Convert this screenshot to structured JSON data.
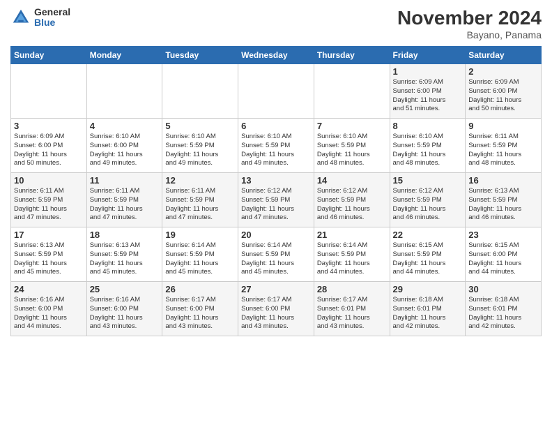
{
  "logo": {
    "general": "General",
    "blue": "Blue"
  },
  "title": "November 2024",
  "subtitle": "Bayano, Panama",
  "headers": [
    "Sunday",
    "Monday",
    "Tuesday",
    "Wednesday",
    "Thursday",
    "Friday",
    "Saturday"
  ],
  "weeks": [
    [
      {
        "day": "",
        "info": ""
      },
      {
        "day": "",
        "info": ""
      },
      {
        "day": "",
        "info": ""
      },
      {
        "day": "",
        "info": ""
      },
      {
        "day": "",
        "info": ""
      },
      {
        "day": "1",
        "info": "Sunrise: 6:09 AM\nSunset: 6:00 PM\nDaylight: 11 hours\nand 51 minutes."
      },
      {
        "day": "2",
        "info": "Sunrise: 6:09 AM\nSunset: 6:00 PM\nDaylight: 11 hours\nand 50 minutes."
      }
    ],
    [
      {
        "day": "3",
        "info": "Sunrise: 6:09 AM\nSunset: 6:00 PM\nDaylight: 11 hours\nand 50 minutes."
      },
      {
        "day": "4",
        "info": "Sunrise: 6:10 AM\nSunset: 6:00 PM\nDaylight: 11 hours\nand 49 minutes."
      },
      {
        "day": "5",
        "info": "Sunrise: 6:10 AM\nSunset: 5:59 PM\nDaylight: 11 hours\nand 49 minutes."
      },
      {
        "day": "6",
        "info": "Sunrise: 6:10 AM\nSunset: 5:59 PM\nDaylight: 11 hours\nand 49 minutes."
      },
      {
        "day": "7",
        "info": "Sunrise: 6:10 AM\nSunset: 5:59 PM\nDaylight: 11 hours\nand 48 minutes."
      },
      {
        "day": "8",
        "info": "Sunrise: 6:10 AM\nSunset: 5:59 PM\nDaylight: 11 hours\nand 48 minutes."
      },
      {
        "day": "9",
        "info": "Sunrise: 6:11 AM\nSunset: 5:59 PM\nDaylight: 11 hours\nand 48 minutes."
      }
    ],
    [
      {
        "day": "10",
        "info": "Sunrise: 6:11 AM\nSunset: 5:59 PM\nDaylight: 11 hours\nand 47 minutes."
      },
      {
        "day": "11",
        "info": "Sunrise: 6:11 AM\nSunset: 5:59 PM\nDaylight: 11 hours\nand 47 minutes."
      },
      {
        "day": "12",
        "info": "Sunrise: 6:11 AM\nSunset: 5:59 PM\nDaylight: 11 hours\nand 47 minutes."
      },
      {
        "day": "13",
        "info": "Sunrise: 6:12 AM\nSunset: 5:59 PM\nDaylight: 11 hours\nand 47 minutes."
      },
      {
        "day": "14",
        "info": "Sunrise: 6:12 AM\nSunset: 5:59 PM\nDaylight: 11 hours\nand 46 minutes."
      },
      {
        "day": "15",
        "info": "Sunrise: 6:12 AM\nSunset: 5:59 PM\nDaylight: 11 hours\nand 46 minutes."
      },
      {
        "day": "16",
        "info": "Sunrise: 6:13 AM\nSunset: 5:59 PM\nDaylight: 11 hours\nand 46 minutes."
      }
    ],
    [
      {
        "day": "17",
        "info": "Sunrise: 6:13 AM\nSunset: 5:59 PM\nDaylight: 11 hours\nand 45 minutes."
      },
      {
        "day": "18",
        "info": "Sunrise: 6:13 AM\nSunset: 5:59 PM\nDaylight: 11 hours\nand 45 minutes."
      },
      {
        "day": "19",
        "info": "Sunrise: 6:14 AM\nSunset: 5:59 PM\nDaylight: 11 hours\nand 45 minutes."
      },
      {
        "day": "20",
        "info": "Sunrise: 6:14 AM\nSunset: 5:59 PM\nDaylight: 11 hours\nand 45 minutes."
      },
      {
        "day": "21",
        "info": "Sunrise: 6:14 AM\nSunset: 5:59 PM\nDaylight: 11 hours\nand 44 minutes."
      },
      {
        "day": "22",
        "info": "Sunrise: 6:15 AM\nSunset: 5:59 PM\nDaylight: 11 hours\nand 44 minutes."
      },
      {
        "day": "23",
        "info": "Sunrise: 6:15 AM\nSunset: 6:00 PM\nDaylight: 11 hours\nand 44 minutes."
      }
    ],
    [
      {
        "day": "24",
        "info": "Sunrise: 6:16 AM\nSunset: 6:00 PM\nDaylight: 11 hours\nand 44 minutes."
      },
      {
        "day": "25",
        "info": "Sunrise: 6:16 AM\nSunset: 6:00 PM\nDaylight: 11 hours\nand 43 minutes."
      },
      {
        "day": "26",
        "info": "Sunrise: 6:17 AM\nSunset: 6:00 PM\nDaylight: 11 hours\nand 43 minutes."
      },
      {
        "day": "27",
        "info": "Sunrise: 6:17 AM\nSunset: 6:00 PM\nDaylight: 11 hours\nand 43 minutes."
      },
      {
        "day": "28",
        "info": "Sunrise: 6:17 AM\nSunset: 6:01 PM\nDaylight: 11 hours\nand 43 minutes."
      },
      {
        "day": "29",
        "info": "Sunrise: 6:18 AM\nSunset: 6:01 PM\nDaylight: 11 hours\nand 42 minutes."
      },
      {
        "day": "30",
        "info": "Sunrise: 6:18 AM\nSunset: 6:01 PM\nDaylight: 11 hours\nand 42 minutes."
      }
    ]
  ]
}
